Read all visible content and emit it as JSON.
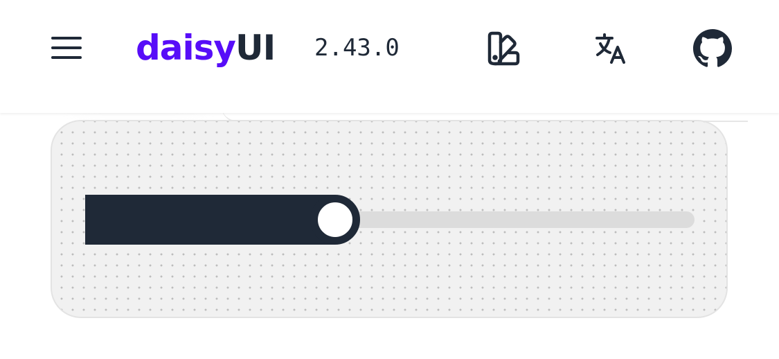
{
  "header": {
    "logo": {
      "accent_text": "daisy",
      "dark_text": "UI"
    },
    "version": "2.43.0",
    "icons": {
      "menu": "hamburger-menu-icon",
      "theme": "swatch-book-icon",
      "language": "translate-icon",
      "github": "github-icon"
    }
  },
  "colors": {
    "brand_accent": "#570df8",
    "neutral": "#1f2937",
    "card_background": "#f1f1f1",
    "track": "#dcdcdc"
  },
  "range": {
    "min": 0,
    "max": 100,
    "value": 41
  }
}
